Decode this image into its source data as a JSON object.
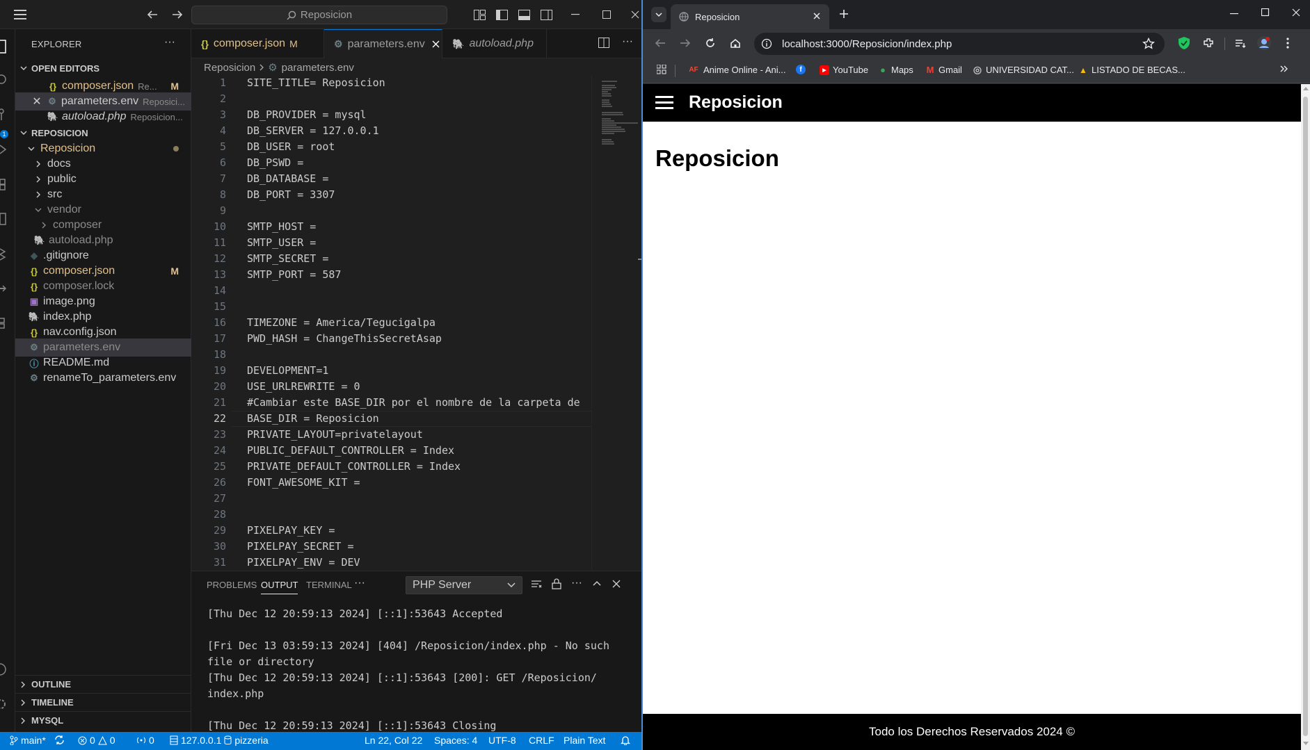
{
  "vscode": {
    "search_label": "Reposicion",
    "explorer": {
      "title": "EXPLORER",
      "open_editors_header": "OPEN EDITORS",
      "open_editors": [
        {
          "name": "composer.json",
          "desc": "Re...",
          "status": "M",
          "icon": "json-icon"
        },
        {
          "name": "parameters.env",
          "desc": "Reposici...",
          "status": "",
          "icon": "gear-icon"
        },
        {
          "name": "autoload.php",
          "desc": "Reposicion...",
          "status": "",
          "icon": "php-icon"
        }
      ],
      "workspace_header": "REPOSICION",
      "tree": [
        {
          "name": "Reposicion",
          "kind": "folder-open"
        },
        {
          "name": "docs",
          "kind": "folder"
        },
        {
          "name": "public",
          "kind": "folder"
        },
        {
          "name": "src",
          "kind": "folder"
        },
        {
          "name": "vendor",
          "kind": "folder-open"
        },
        {
          "name": "composer",
          "kind": "folder"
        },
        {
          "name": "autoload.php",
          "kind": "php"
        },
        {
          "name": ".gitignore",
          "kind": "git"
        },
        {
          "name": "composer.json",
          "kind": "json",
          "status": "M"
        },
        {
          "name": "composer.lock",
          "kind": "json"
        },
        {
          "name": "image.png",
          "kind": "image"
        },
        {
          "name": "index.php",
          "kind": "php"
        },
        {
          "name": "nav.config.json",
          "kind": "json"
        },
        {
          "name": "parameters.env",
          "kind": "gear"
        },
        {
          "name": "README.md",
          "kind": "info"
        },
        {
          "name": "renameTo_parameters.env",
          "kind": "gear"
        }
      ],
      "outline": "OUTLINE",
      "timeline": "TIMELINE",
      "mysql": "MYSQL"
    },
    "tabs": [
      {
        "label": "composer.json",
        "mod": "M"
      },
      {
        "label": "parameters.env",
        "mod": ""
      },
      {
        "label": "autoload.php",
        "mod": ""
      }
    ],
    "breadcrumb": {
      "folder": "Reposicion",
      "file": "parameters.env"
    },
    "code_lines": [
      "SITE_TITLE= Reposicion",
      "",
      "DB_PROVIDER = mysql",
      "DB_SERVER = 127.0.0.1",
      "DB_USER = root",
      "DB_PSWD =",
      "DB_DATABASE =",
      "DB_PORT = 3307",
      "",
      "SMTP_HOST =",
      "SMTP_USER =",
      "SMTP_SECRET =",
      "SMTP_PORT = 587",
      "",
      "",
      "TIMEZONE = America/Tegucigalpa",
      "PWD_HASH = ChangeThisSecretAsap",
      "",
      "DEVELOPMENT=1",
      "USE_URLREWRITE = 0",
      "#Cambiar este BASE_DIR por el nombre de la carpeta de",
      "BASE_DIR = Reposicion",
      "PRIVATE_LAYOUT=privatelayout",
      "PUBLIC_DEFAULT_CONTROLLER = Index",
      "PRIVATE_DEFAULT_CONTROLLER = Index",
      "FONT_AWESOME_KIT =",
      "",
      "",
      "PIXELPAY_KEY =",
      "PIXELPAY_SECRET =",
      "PIXELPAY_ENV = DEV"
    ],
    "line_numbers": [
      "1",
      "2",
      "3",
      "4",
      "5",
      "6",
      "7",
      "8",
      "9",
      "10",
      "11",
      "12",
      "13",
      "14",
      "15",
      "16",
      "17",
      "18",
      "19",
      "20",
      "21",
      "22",
      "23",
      "24",
      "25",
      "26",
      "27",
      "28",
      "29",
      "30",
      "31"
    ],
    "current_line": 22,
    "panel": {
      "tabs": [
        "PROBLEMS",
        "OUTPUT",
        "TERMINAL"
      ],
      "active_tab": "OUTPUT",
      "select_value": "PHP Server",
      "output": [
        "[Thu Dec 12 20:59:13 2024] [::1]:53643 Accepted",
        "",
        "[Fri Dec 13 03:59:13 2024] [404] /Reposicion/index.php - No such",
        "file or directory",
        "[Thu Dec 12 20:59:13 2024] [::1]:53643 [200]: GET /Reposicion/",
        "index.php",
        "",
        "[Thu Dec 12 20:59:13 2024] [::1]:53643 Closing"
      ]
    },
    "status": {
      "branch": "main*",
      "errors": "0",
      "warnings": "0",
      "ports": "0",
      "db_host": "127.0.0.1",
      "db_name": "pizzeria",
      "position": "Ln 22, Col 22",
      "spaces": "Spaces: 4",
      "encoding": "UTF-8",
      "eol": "CRLF",
      "language": "Plain Text"
    }
  },
  "browser": {
    "tab_title": "Reposicion",
    "url": "localhost:3000/Reposicion/index.php",
    "bookmarks": [
      {
        "label": "Anime Online - Ani...",
        "color": "#c0392b",
        "glyph": "AF"
      },
      {
        "label": "",
        "color": "#1877f2",
        "glyph": "f"
      },
      {
        "label": "YouTube",
        "color": "#ff0000",
        "glyph": "▶"
      },
      {
        "label": "Maps",
        "color": "#34a853",
        "glyph": "●"
      },
      {
        "label": "Gmail",
        "color": "#ea4335",
        "glyph": "M"
      },
      {
        "label": "UNIVERSIDAD CAT...",
        "color": "#777777",
        "glyph": "◎"
      },
      {
        "label": "LISTADO DE BECAS...",
        "color": "#fbbc04",
        "glyph": "▲"
      }
    ],
    "page": {
      "brand": "Reposicion",
      "heading": "Reposicion",
      "footer": "Todo los Derechos Reservados 2024 ©"
    }
  }
}
